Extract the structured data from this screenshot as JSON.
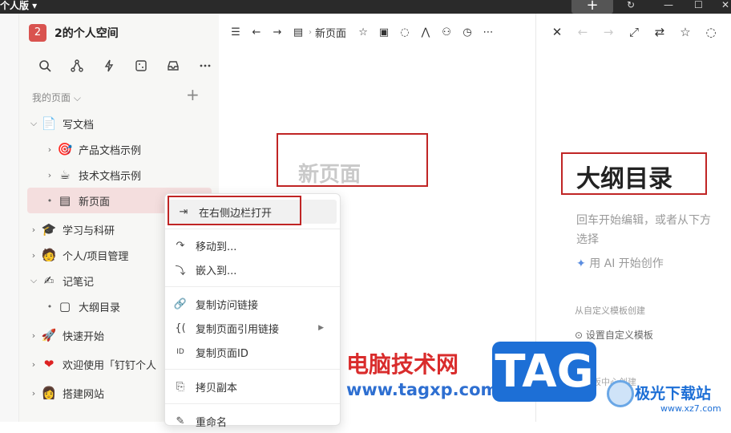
{
  "topbar": {
    "version": "个人版 ▾",
    "plus": "+",
    "controls": [
      "↻",
      "—",
      "☐",
      "✕"
    ]
  },
  "workspace": {
    "badge": "2",
    "name": "2的个人空间"
  },
  "sidebar": {
    "my_pages": "我的页面 ⌵",
    "add": "+",
    "items": [
      {
        "label": "写文档",
        "arrow": "⌵",
        "icon": "📄"
      },
      {
        "label": "产品文档示例",
        "arrow": "›",
        "icon": "🎯"
      },
      {
        "label": "技术文档示例",
        "arrow": "›",
        "icon": "☕"
      },
      {
        "label": "新页面",
        "arrow": "•",
        "icon": "▤"
      },
      {
        "label": "学习与科研",
        "arrow": "›",
        "icon": "🎓"
      },
      {
        "label": "个人/项目管理",
        "arrow": "›",
        "icon": "🧑"
      },
      {
        "label": "记笔记",
        "arrow": "⌵",
        "icon": "✍"
      },
      {
        "label": "大纲目录",
        "arrow": "•",
        "icon": "▢"
      },
      {
        "label": "快速开始",
        "arrow": "›",
        "icon": "🚀"
      },
      {
        "label": "欢迎使用「钉钉个人",
        "arrow": "›",
        "icon": "❤"
      },
      {
        "label": "搭建网站",
        "arrow": "›",
        "icon": "👩"
      }
    ]
  },
  "main": {
    "breadcrumb": "新页面",
    "page_title": "新页面"
  },
  "right": {
    "title": "大纲目录",
    "hint": "回车开始编辑，或者从下方选择",
    "ai_icon": "✦",
    "ai": "用 AI 开始创作",
    "template_heading": "从自定义模板创建",
    "template_set": "⊙ 设置自定义模板",
    "template_center": "从模板中心创建"
  },
  "menu": {
    "items": [
      {
        "label": "在右侧边栏打开",
        "icon": "⇥"
      },
      {
        "label": "移动到...",
        "icon": "↷"
      },
      {
        "label": "嵌入到...",
        "icon": "⤵"
      },
      {
        "label": "复制访问链接",
        "icon": "🔗"
      },
      {
        "label": "复制页面引用链接",
        "icon": "{(",
        "submenu": "▶"
      },
      {
        "label": "复制页面ID",
        "icon": "ID"
      },
      {
        "label": "拷贝副本",
        "icon": "⎘"
      },
      {
        "label": "重命名",
        "icon": "✎"
      }
    ]
  },
  "watermark": {
    "site_cn": "电脑技术网",
    "url": "www.tagxp.com",
    "tag": "TAG",
    "brand": "极光下载站",
    "brand_url": "www.xz7.com"
  }
}
